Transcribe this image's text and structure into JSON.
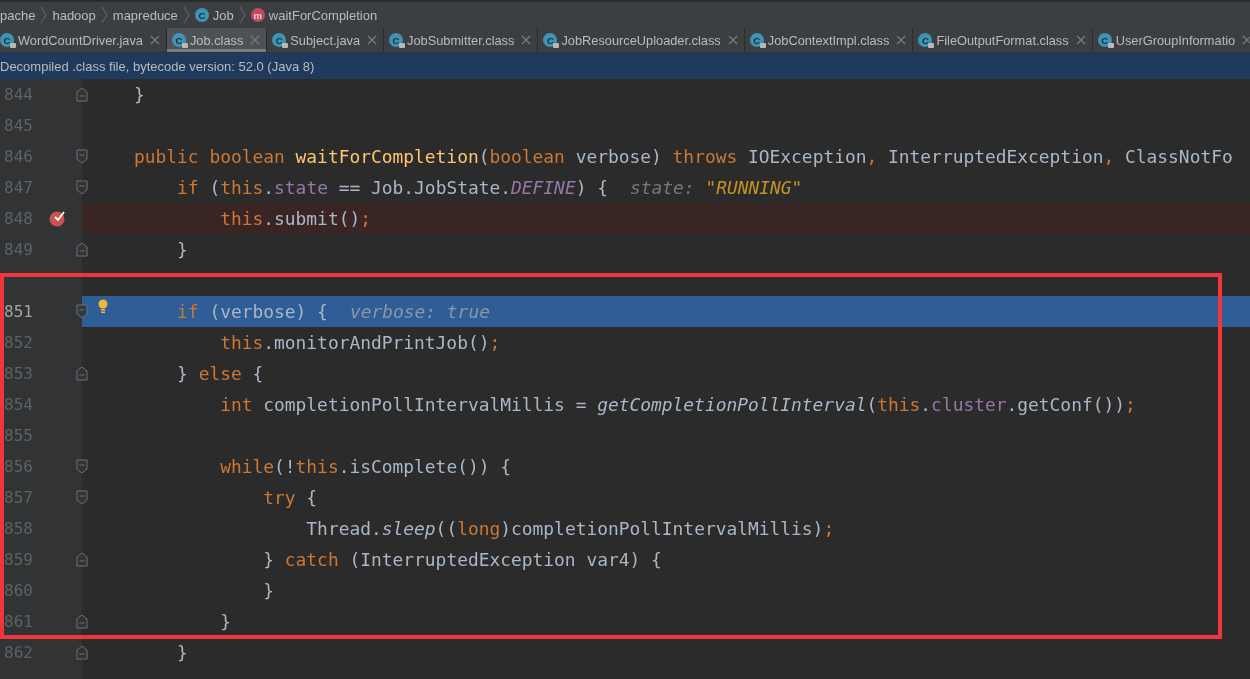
{
  "breadcrumb": [
    {
      "text": "pache"
    },
    {
      "text": "hadoop"
    },
    {
      "text": "mapreduce"
    },
    {
      "text": "Job",
      "icon": "C",
      "kind": "class"
    },
    {
      "text": "waitForCompletion",
      "icon": "m",
      "kind": "method"
    }
  ],
  "tabs": [
    {
      "label": "WordCountDriver.java",
      "icon": "C",
      "selected": false
    },
    {
      "label": "Job.class",
      "icon": "C",
      "selected": true
    },
    {
      "label": "Subject.java",
      "icon": "C",
      "selected": false
    },
    {
      "label": "JobSubmitter.class",
      "icon": "C",
      "selected": false
    },
    {
      "label": "JobResourceUploader.class",
      "icon": "C",
      "selected": false
    },
    {
      "label": "JobContextImpl.class",
      "icon": "C",
      "selected": false
    },
    {
      "label": "FileOutputFormat.class",
      "icon": "C",
      "selected": false
    },
    {
      "label": "UserGroupInformatio",
      "icon": "C",
      "selected": false
    }
  ],
  "banner": "Decompiled .class file, bytecode version: 52.0 (Java 8)",
  "lines": [
    {
      "number": "844",
      "block_end": true,
      "tokens": [
        {
          "t": "}",
          "kind": "plain"
        }
      ]
    },
    {
      "number": "845"
    },
    {
      "number": "846",
      "block_start": true,
      "tokens": [
        {
          "t": "public ",
          "kind": "keyword"
        },
        {
          "t": "boolean ",
          "kind": "keyword"
        },
        {
          "t": "waitForCompletion",
          "kind": "declaration"
        },
        {
          "t": "(",
          "kind": "plain"
        },
        {
          "t": "boolean ",
          "kind": "keyword"
        },
        {
          "t": "verbose) ",
          "kind": "plain"
        },
        {
          "t": "throws ",
          "kind": "keyword"
        },
        {
          "t": "IOException",
          "kind": "plain"
        },
        {
          "t": ", ",
          "kind": "keyword"
        },
        {
          "t": "InterruptedException",
          "kind": "plain"
        },
        {
          "t": ", ",
          "kind": "keyword"
        },
        {
          "t": "ClassNotFo",
          "kind": "plain"
        }
      ]
    },
    {
      "number": "847",
      "block_start": true,
      "tokens": [
        {
          "t": "    if ",
          "kind": "keyword"
        },
        {
          "t": "(",
          "kind": "plain"
        },
        {
          "t": "this",
          "kind": "keyword"
        },
        {
          "t": ".",
          "kind": "plain"
        },
        {
          "t": "state",
          "kind": "field"
        },
        {
          "t": " == Job.JobState.",
          "kind": "plain"
        },
        {
          "t": "DEFINE",
          "kind": "constant"
        },
        {
          "t": ") {",
          "kind": "plain"
        }
      ],
      "hint": {
        "label": "state:",
        "value": "\"RUNNING\"",
        "kind": "string"
      }
    },
    {
      "number": "848",
      "breakpoint": true,
      "tokens": [
        {
          "t": "        this",
          "kind": "keyword"
        },
        {
          "t": ".submit()",
          "kind": "plain"
        },
        {
          "t": ";",
          "kind": "keyword"
        }
      ]
    },
    {
      "number": "849",
      "block_end": true,
      "tokens": [
        {
          "t": "    }",
          "kind": "plain"
        }
      ]
    },
    {
      "framed": true
    },
    {
      "number": "851",
      "framed": true,
      "block_start": true,
      "current": true,
      "bulb": true,
      "tokens": [
        {
          "t": "    if ",
          "kind": "keyword"
        },
        {
          "t": "(verbose) {",
          "kind": "plain"
        }
      ],
      "hint": {
        "label": "verbose:",
        "value": "true",
        "kind": "plain"
      }
    },
    {
      "number": "852",
      "framed": true,
      "tokens": [
        {
          "t": "        this",
          "kind": "keyword"
        },
        {
          "t": ".monitorAndPrintJob()",
          "kind": "plain"
        },
        {
          "t": ";",
          "kind": "keyword"
        }
      ]
    },
    {
      "number": "853",
      "framed": true,
      "block_end": true,
      "tokens": [
        {
          "t": "    } ",
          "kind": "plain"
        },
        {
          "t": "else ",
          "kind": "keyword"
        },
        {
          "t": "{",
          "kind": "plain"
        }
      ]
    },
    {
      "number": "854",
      "framed": true,
      "tokens": [
        {
          "t": "        int ",
          "kind": "keyword"
        },
        {
          "t": "completionPollIntervalMillis = ",
          "kind": "plain"
        },
        {
          "t": "getCompletionPollInterval",
          "kind": "static"
        },
        {
          "t": "(",
          "kind": "plain"
        },
        {
          "t": "this",
          "kind": "keyword"
        },
        {
          "t": ".",
          "kind": "plain"
        },
        {
          "t": "cluster",
          "kind": "field"
        },
        {
          "t": ".getConf())",
          "kind": "plain"
        },
        {
          "t": ";",
          "kind": "keyword"
        }
      ]
    },
    {
      "number": "855",
      "framed": true
    },
    {
      "number": "856",
      "framed": true,
      "block_start": true,
      "tokens": [
        {
          "t": "        while",
          "kind": "keyword"
        },
        {
          "t": "(!",
          "kind": "plain"
        },
        {
          "t": "this",
          "kind": "keyword"
        },
        {
          "t": ".isComplete()) {",
          "kind": "plain"
        }
      ]
    },
    {
      "number": "857",
      "framed": true,
      "block_start": true,
      "tokens": [
        {
          "t": "            try ",
          "kind": "keyword"
        },
        {
          "t": "{",
          "kind": "plain"
        }
      ]
    },
    {
      "number": "858",
      "framed": true,
      "tokens": [
        {
          "t": "                Thread.",
          "kind": "plain"
        },
        {
          "t": "sleep",
          "kind": "static"
        },
        {
          "t": "((",
          "kind": "plain"
        },
        {
          "t": "long",
          "kind": "keyword"
        },
        {
          "t": ")completionPollIntervalMillis)",
          "kind": "plain"
        },
        {
          "t": ";",
          "kind": "keyword"
        }
      ]
    },
    {
      "number": "859",
      "framed": true,
      "block_end": true,
      "tokens": [
        {
          "t": "            } ",
          "kind": "plain"
        },
        {
          "t": "catch ",
          "kind": "keyword"
        },
        {
          "t": "(InterruptedException var4) {",
          "kind": "plain"
        }
      ]
    },
    {
      "number": "860",
      "framed": true,
      "tokens": [
        {
          "t": "            }",
          "kind": "plain"
        }
      ]
    },
    {
      "number": "861",
      "framed": true,
      "block_end": true,
      "tokens": [
        {
          "t": "        }",
          "kind": "plain"
        }
      ]
    },
    {
      "number": "862",
      "block_end": true,
      "tokens": [
        {
          "t": "    }",
          "kind": "plain"
        }
      ]
    }
  ]
}
